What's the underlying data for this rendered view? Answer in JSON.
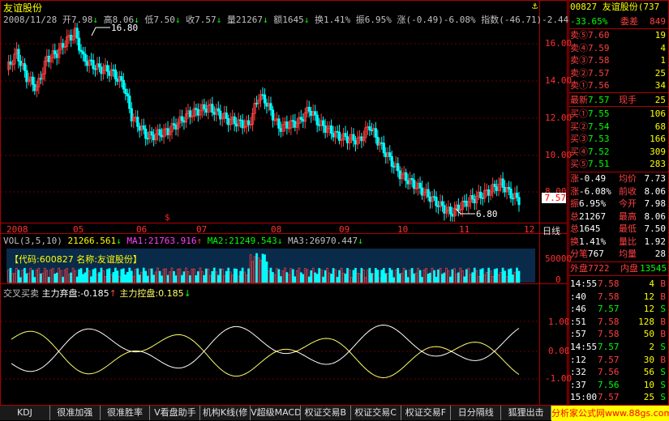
{
  "stock": {
    "name": "友谊股份",
    "code_name": "00827 友谊股份",
    "code_suffix": "(737"
  },
  "info_bar": {
    "date": "2008/11/28",
    "open": "开7.98",
    "high": "高8.06",
    "low": "低7.50",
    "close": "收7.57",
    "volume": "量21267",
    "amount": "额1645",
    "turnover": "换1.41%",
    "amplitude": "振6.95%",
    "change": "涨(-0.49)-6.08%",
    "index": "指数(-46.71)-2.44"
  },
  "price_axis": [
    "16.00",
    "14.00",
    "12.00",
    "10.00",
    "8.00"
  ],
  "current_price": "7.57",
  "price_marks": {
    "high": "16.80",
    "low": "6.80",
    "event": "$"
  },
  "time_axis": [
    "2008",
    "05",
    "06",
    "07",
    "08",
    "09",
    "10",
    "11",
    "12"
  ],
  "period_label": "日线",
  "volume_header": {
    "vol_label": "VOL(3,5,10)",
    "vol_value": "21266.561",
    "ma1": "MA1:21763.916",
    "ma2": "MA2:21249.543",
    "ma3": "MA3:26970.447"
  },
  "volume_axis": [
    "50000",
    "0"
  ],
  "volume_overlay": "【代码:600827 名称:友谊股份】",
  "indicator_header": {
    "name": "交叉买卖",
    "abandon": "主力弃盘:-0.185",
    "control": "主力控盘:0.185"
  },
  "indicator_axis": [
    "1.00",
    "0.00",
    "-1.00"
  ],
  "right_panel": {
    "ratio": "委比",
    "ratio_value": "-33.65%",
    "diff": "委差",
    "diff_value": "849",
    "sells": [
      {
        "label": "卖⑤",
        "price": "7.60",
        "vol": "19"
      },
      {
        "label": "卖④",
        "price": "7.59",
        "vol": "4"
      },
      {
        "label": "卖③",
        "price": "7.58",
        "vol": "1"
      },
      {
        "label": "卖②",
        "price": "7.57",
        "vol": "25"
      },
      {
        "label": "卖①",
        "price": "7.56",
        "vol": "34"
      }
    ],
    "last_label": "最新",
    "last_price": "7.57",
    "hand_label": "现手",
    "hand_value": "25",
    "buys": [
      {
        "label": "买①",
        "price": "7.55",
        "vol": "106"
      },
      {
        "label": "买②",
        "price": "7.54",
        "vol": "68"
      },
      {
        "label": "买③",
        "price": "7.53",
        "vol": "166"
      },
      {
        "label": "买④",
        "price": "7.52",
        "vol": "309"
      },
      {
        "label": "买⑤",
        "price": "7.51",
        "vol": "283"
      }
    ],
    "stats": [
      {
        "l1": "涨",
        "v1": "-0.49",
        "l2": "均价",
        "v2": "7.73"
      },
      {
        "l1": "涨",
        "v1": "-6.08%",
        "l2": "前收",
        "v2": "8.06"
      },
      {
        "l1": "振",
        "v1": "6.95%",
        "l2": "今开",
        "v2": "7.98"
      },
      {
        "l1": "总",
        "v1": "21267",
        "l2": "最高",
        "v2": "8.06"
      },
      {
        "l1": "总",
        "v1": "1645",
        "l2": "最低",
        "v2": "7.50"
      },
      {
        "l1": "分笔",
        "v1": "",
        "l2": "最低",
        "v2": "7.50"
      },
      {
        "l1": "换",
        "v1": "1.41%",
        "l2": "量比",
        "v2": "1.92"
      },
      {
        "l1": "分笔",
        "v1": "767",
        "l2": "均量",
        "v2": "28"
      }
    ],
    "outer": "外盘",
    "outer_value": "7722",
    "inner": "内盘",
    "inner_value": "13545",
    "ticks": [
      {
        "time": "14:55",
        "price": "7.58",
        "vol": "4",
        "dir": "B"
      },
      {
        "time": ":40",
        "price": "7.58",
        "vol": "12",
        "dir": "B"
      },
      {
        "time": ":46",
        "price": "7.57",
        "vol": "12",
        "dir": "S"
      },
      {
        "time": ":51",
        "price": "7.58",
        "vol": "128",
        "dir": "B"
      },
      {
        "time": ":57",
        "price": "7.58",
        "vol": "50",
        "dir": "B"
      },
      {
        "time": "14:55",
        "price": "7.57",
        "vol": "2",
        "dir": "S"
      },
      {
        "time": ":12",
        "price": "7.57",
        "vol": "30",
        "dir": "B"
      },
      {
        "time": ":32",
        "price": "7.56",
        "vol": "56",
        "dir": "S"
      },
      {
        "time": ":37",
        "price": "7.56",
        "vol": "10",
        "dir": "S"
      },
      {
        "time": "15:00",
        "price": "7.57",
        "vol": "25",
        "dir": "S"
      }
    ]
  },
  "tabs": [
    "KDJ",
    "很准加强",
    "很准胜率",
    "V看盘助手",
    "机构K线(修",
    "V超级MACD",
    "权证交易B",
    "权证交易C",
    "权证交易F",
    "日分隔线",
    "狐狸出击"
  ],
  "brand": "分析家公式网www.88gs.com",
  "colors": {
    "up": "#ff4040",
    "down": "#00ffff",
    "grid": "#b00000",
    "osc_yellow": "#ffff66",
    "osc_white": "#ffffff"
  }
}
